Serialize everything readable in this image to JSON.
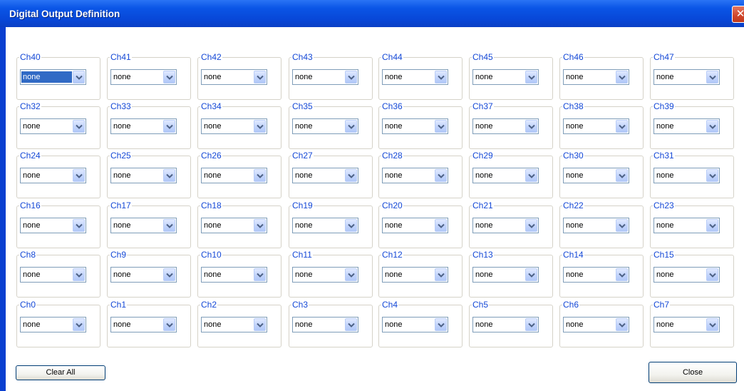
{
  "window": {
    "title": "Digital Output Definition",
    "close_glyph": "✕"
  },
  "channel_rows": [
    [
      {
        "label": "Ch40",
        "value": "none",
        "focused": true
      },
      {
        "label": "Ch41",
        "value": "none"
      },
      {
        "label": "Ch42",
        "value": "none"
      },
      {
        "label": "Ch43",
        "value": "none"
      },
      {
        "label": "Ch44",
        "value": "none"
      },
      {
        "label": "Ch45",
        "value": "none"
      },
      {
        "label": "Ch46",
        "value": "none"
      },
      {
        "label": "Ch47",
        "value": "none"
      }
    ],
    [
      {
        "label": "Ch32",
        "value": "none"
      },
      {
        "label": "Ch33",
        "value": "none"
      },
      {
        "label": "Ch34",
        "value": "none"
      },
      {
        "label": "Ch35",
        "value": "none"
      },
      {
        "label": "Ch36",
        "value": "none"
      },
      {
        "label": "Ch37",
        "value": "none"
      },
      {
        "label": "Ch38",
        "value": "none"
      },
      {
        "label": "Ch39",
        "value": "none"
      }
    ],
    [
      {
        "label": "Ch24",
        "value": "none"
      },
      {
        "label": "Ch25",
        "value": "none"
      },
      {
        "label": "Ch26",
        "value": "none"
      },
      {
        "label": "Ch27",
        "value": "none"
      },
      {
        "label": "Ch28",
        "value": "none"
      },
      {
        "label": "Ch29",
        "value": "none"
      },
      {
        "label": "Ch30",
        "value": "none"
      },
      {
        "label": "Ch31",
        "value": "none"
      }
    ],
    [
      {
        "label": "Ch16",
        "value": "none"
      },
      {
        "label": "Ch17",
        "value": "none"
      },
      {
        "label": "Ch18",
        "value": "none"
      },
      {
        "label": "Ch19",
        "value": "none"
      },
      {
        "label": "Ch20",
        "value": "none"
      },
      {
        "label": "Ch21",
        "value": "none"
      },
      {
        "label": "Ch22",
        "value": "none"
      },
      {
        "label": "Ch23",
        "value": "none"
      }
    ],
    [
      {
        "label": "Ch8",
        "value": "none"
      },
      {
        "label": "Ch9",
        "value": "none"
      },
      {
        "label": "Ch10",
        "value": "none"
      },
      {
        "label": "Ch11",
        "value": "none"
      },
      {
        "label": "Ch12",
        "value": "none"
      },
      {
        "label": "Ch13",
        "value": "none"
      },
      {
        "label": "Ch14",
        "value": "none"
      },
      {
        "label": "Ch15",
        "value": "none"
      }
    ],
    [
      {
        "label": "Ch0",
        "value": "none"
      },
      {
        "label": "Ch1",
        "value": "none"
      },
      {
        "label": "Ch2",
        "value": "none"
      },
      {
        "label": "Ch3",
        "value": "none"
      },
      {
        "label": "Ch4",
        "value": "none"
      },
      {
        "label": "Ch5",
        "value": "none"
      },
      {
        "label": "Ch6",
        "value": "none"
      },
      {
        "label": "Ch7",
        "value": "none"
      }
    ]
  ],
  "buttons": {
    "clear_all": "Clear All",
    "close": "Close"
  },
  "icons": {
    "close": "close-icon",
    "dropdown": "chevron-down-icon"
  },
  "colors": {
    "titlebar": "#0a55e6",
    "frame": "#0a3fd0",
    "group_label": "#1448d6",
    "group_border": "#d5d2c8",
    "selection": "#316ac5"
  }
}
